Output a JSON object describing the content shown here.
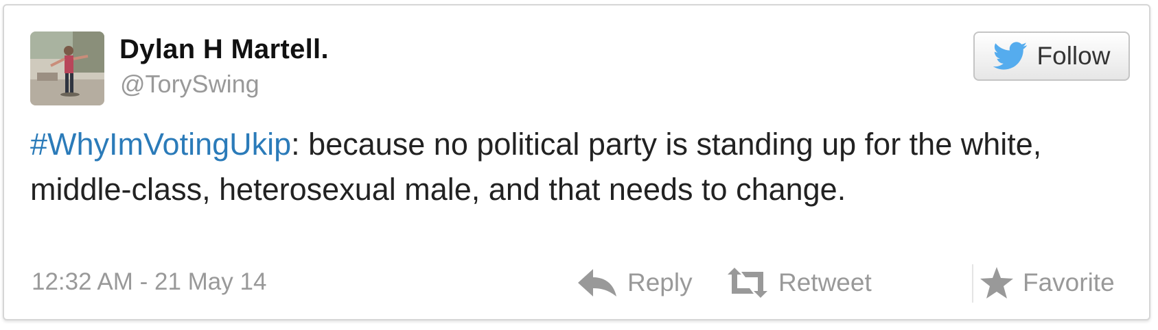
{
  "tweet": {
    "display_name": "Dylan H Martell.",
    "handle": "@TorySwing",
    "hashtag": "#WhyImVotingUkip",
    "text": ": because no political party is standing up for the white, middle-class, heterosexual male, and that needs to change.",
    "timestamp": "12:32 AM - 21 May 14"
  },
  "follow_button": {
    "label": "Follow",
    "icon": "twitter-bird-icon"
  },
  "actions": [
    {
      "label": "Reply",
      "icon": "reply-icon"
    },
    {
      "label": "Retweet",
      "icon": "retweet-icon"
    },
    {
      "label": "Favorite",
      "icon": "star-icon"
    }
  ],
  "colors": {
    "link": "#2b7bb9",
    "twitter_blue": "#55acee",
    "muted_text": "#999999",
    "body_text": "#222222",
    "icon_gray": "#999999"
  }
}
